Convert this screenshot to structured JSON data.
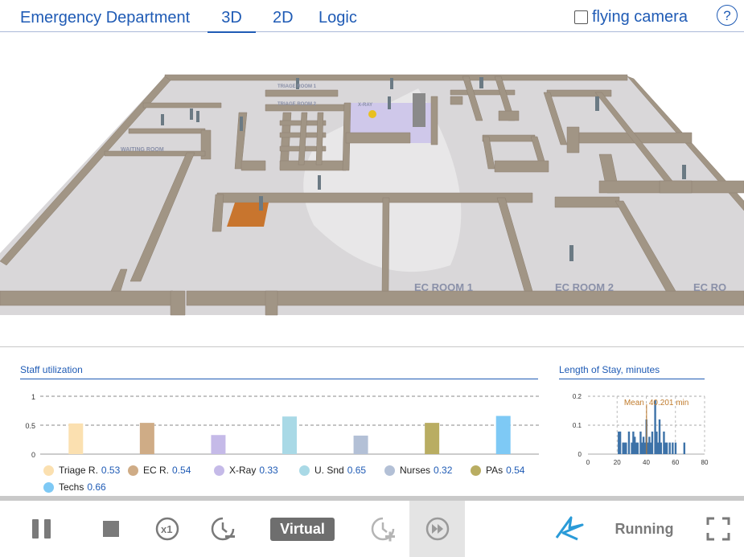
{
  "header": {
    "model_title": "Emergency Department",
    "tabs": [
      {
        "label": "3D",
        "active": true
      },
      {
        "label": "2D",
        "active": false
      },
      {
        "label": "Logic",
        "active": false
      }
    ],
    "flying_camera": {
      "label": "flying camera",
      "checked": false
    },
    "help_label": "?"
  },
  "scene": {
    "room_labels": [
      "WAITING ROOM",
      "X-RAY",
      "TRIAGE ROOM 1",
      "TRIAGE ROOM 2",
      "EC ROOM 1",
      "EC ROOM 2",
      "EC RO"
    ]
  },
  "staff_chart": {
    "title": "Staff utilization",
    "y_ticks": [
      "1",
      "0.5",
      "0"
    ],
    "legend": [
      {
        "name": "Triage R.",
        "value": "0.53",
        "color": "#fbe0b0"
      },
      {
        "name": "EC R.",
        "value": "0.54",
        "color": "#cfac86"
      },
      {
        "name": "X-Ray",
        "value": "0.33",
        "color": "#c5bae8"
      },
      {
        "name": "U. Snd",
        "value": "0.65",
        "color": "#a9d9e6"
      },
      {
        "name": "Nurses",
        "value": "0.32",
        "color": "#b3c0d6"
      },
      {
        "name": "PAs",
        "value": "0.54",
        "color": "#b9ad62"
      },
      {
        "name": "Techs",
        "value": "0.66",
        "color": "#7ec9f5"
      }
    ]
  },
  "stay_chart": {
    "title": "Length of Stay, minutes",
    "mean_label": "Mean",
    "mean_value_label": "40.201 min",
    "y_ticks": [
      "0.2",
      "0.1",
      "0"
    ],
    "x_ticks": [
      "0",
      "20",
      "40",
      "60",
      "80"
    ]
  },
  "chart_data": [
    {
      "type": "bar",
      "title": "Staff utilization",
      "categories": [
        "Triage R.",
        "EC R.",
        "X-Ray",
        "U. Snd",
        "Nurses",
        "PAs",
        "Techs"
      ],
      "values": [
        0.53,
        0.54,
        0.33,
        0.65,
        0.32,
        0.54,
        0.66
      ],
      "ylim": [
        0,
        1
      ]
    },
    {
      "type": "bar",
      "title": "Length of Stay, minutes",
      "x": [
        20,
        21,
        22,
        23,
        24,
        25,
        26,
        28,
        30,
        31,
        32,
        33,
        34,
        36,
        37,
        38,
        39,
        40,
        41,
        42,
        43,
        44,
        45,
        46,
        47,
        48,
        49,
        50,
        52,
        53,
        54,
        56,
        58,
        60,
        66
      ],
      "values": [
        0.0,
        0.078,
        0.078,
        0.0,
        0.04,
        0.04,
        0.04,
        0.078,
        0.04,
        0.078,
        0.06,
        0.04,
        0.04,
        0.078,
        0.04,
        0.06,
        0.04,
        0.12,
        0.04,
        0.06,
        0.04,
        0.078,
        0.0,
        0.186,
        0.078,
        0.04,
        0.12,
        0.04,
        0.078,
        0.04,
        0.04,
        0.04,
        0.04,
        0.04,
        0.04
      ],
      "mean": 40.201,
      "xlim": [
        0,
        80
      ],
      "ylim": [
        0,
        0.2
      ]
    }
  ],
  "toolbar": {
    "pause_icon": "pause-icon",
    "stop_icon": "stop-icon",
    "speed_label": "x1",
    "mode_label": "Virtual",
    "status_label": "Running",
    "accent": "#1f5bb5"
  }
}
